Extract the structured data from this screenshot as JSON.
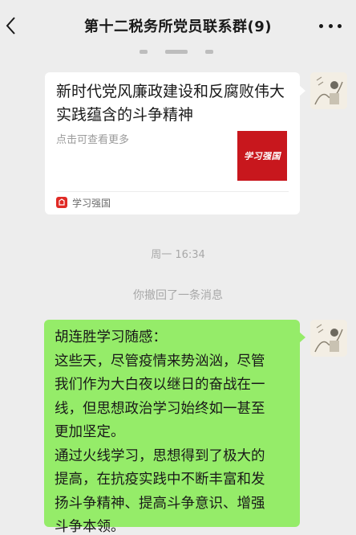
{
  "header": {
    "title": "第十二税务所党员联系群(9)"
  },
  "messages": {
    "link_card": {
      "title": "新时代党风廉政建设和反腐败伟大实践蕴含的斗争精神",
      "description": "点击可查看更多",
      "thumbnail_text": "学习强国",
      "source": "学习强国",
      "brand_color": "#c8171d"
    },
    "timestamp": "周一 16:34",
    "recall_notice": "你撤回了一条消息",
    "text_message": {
      "lines": [
        "胡连胜学习随感：",
        "这些天，尽管疫情来势汹汹，尽管",
        "我们作为大白夜以继日的奋战在一",
        "线，但思想政治学习始终如一甚至",
        "更加坚定。",
        "通过火线学习，思想得到了极大的",
        "提高，在抗疫实践中不断丰富和发",
        "扬斗争精神、提高斗争意识、增强",
        "斗争本领。"
      ],
      "bubble_color": "#95ec69"
    }
  },
  "icons": {
    "back": "chevron-left-icon",
    "more": "more-dots-icon",
    "source": "xuexi-logo-icon"
  }
}
